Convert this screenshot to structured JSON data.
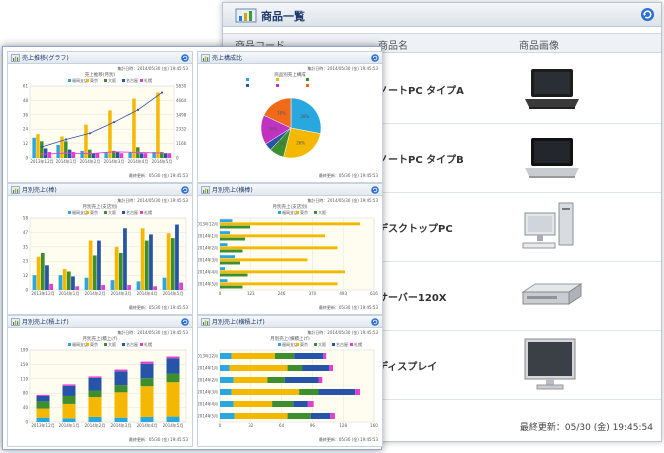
{
  "product_window": {
    "title": "商品一覧",
    "columns": [
      "商品コード",
      "商品名",
      "商品画像"
    ],
    "products": [
      {
        "name": "ノートPC タイプA",
        "icon": "laptop-icon"
      },
      {
        "name": "ノートPC タイプB",
        "icon": "laptop-icon"
      },
      {
        "name": "デスクトップPC",
        "icon": "desktop-pc-icon"
      },
      {
        "name": "サーバー120X",
        "icon": "server-icon"
      },
      {
        "name": "ディスプレイ",
        "icon": "monitor-icon"
      }
    ],
    "last_updated": "最終更新：05/30 (金) 19:45:54"
  },
  "dashboard": {
    "panels": [
      {
        "title": "売上推移(グラフ)",
        "meta": "集計日時：2014/05/30 (金) 19:45:53",
        "subtitle": "売上推移(月別)",
        "date_footer": "最終更新：05/30 (金) 19:45:53"
      },
      {
        "title": "売上構成比",
        "meta": "集計日時：2014/05/30 (金) 19:45:53",
        "subtitle": "商品別売上構成",
        "date_footer": "最終更新：05/30 (金) 19:45:53"
      },
      {
        "title": "月別売上(棒)",
        "meta": "集計日時：2014/05/30 (金) 19:45:53",
        "subtitle": "月別売上(支店別)",
        "date_footer": "最終更新：05/30 (金) 19:45:53"
      },
      {
        "title": "月別売上(横棒)",
        "meta": "集計日時：2014/05/30 (金) 19:45:53",
        "subtitle": "月別売上(支店別)",
        "date_footer": "最終更新：05/30 (金) 19:45:53"
      },
      {
        "title": "月別売上(積上げ)",
        "meta": "集計日時：2014/05/30 (金) 19:45:53",
        "subtitle": "月別売上(積上げ)",
        "date_footer": "最終更新：05/30 (金) 19:45:53"
      },
      {
        "title": "月別売上(横積上げ)",
        "meta": "集計日時：2014/05/30 (金) 19:45:53",
        "subtitle": "月別売上(横積上げ)",
        "date_footer": "最終更新：05/30 (金) 19:45:53"
      }
    ]
  },
  "chart_data": [
    {
      "type": "bar",
      "categories": [
        "2013年12月",
        "2014年1月",
        "2014年2月",
        "2014年3月",
        "2014年4月",
        "2014年5月"
      ],
      "series": [
        {
          "name": "福岡支店",
          "values": [
            17,
            11,
            6,
            5,
            5,
            5
          ]
        },
        {
          "name": "東京",
          "values": [
            20,
            18,
            28,
            40,
            50,
            55
          ]
        },
        {
          "name": "大阪",
          "values": [
            14,
            14,
            7,
            6,
            9,
            5
          ]
        },
        {
          "name": "名古屋",
          "values": [
            8,
            7,
            4,
            5,
            4,
            4
          ]
        },
        {
          "name": "札幌",
          "values": [
            5,
            5,
            4,
            4,
            4,
            4
          ]
        }
      ],
      "line_series": [
        {
          "name": "累計",
          "values": [
            900,
            1500,
            2000,
            2900,
            3900,
            5300
          ]
        },
        {
          "name": "平均",
          "values": [
            300,
            400,
            350,
            500,
            450,
            400
          ]
        }
      ],
      "colors": [
        "#29a8e0",
        "#f5b800",
        "#3d8f2e",
        "#2554a8",
        "#e040d0"
      ]
    },
    {
      "type": "pie",
      "values": [
        28,
        26,
        8,
        4,
        16,
        18
      ],
      "slice_labels": [
        "28%",
        "26%",
        "8%",
        "4%",
        "16%",
        "18%"
      ],
      "colors": [
        "#29a8e0",
        "#f5b800",
        "#3d8f2e",
        "#2554a8",
        "#c032c0",
        "#f06a1a"
      ]
    },
    {
      "type": "bar",
      "categories": [
        "2013年12月",
        "2014年1月",
        "2014年2月",
        "2014年3月",
        "2014年4月",
        "2014年5月"
      ],
      "series": [
        {
          "name": "福岡支店",
          "values": [
            12,
            12,
            10,
            8,
            7,
            10
          ]
        },
        {
          "name": "東京",
          "values": [
            27,
            17,
            40,
            35,
            50,
            46
          ]
        },
        {
          "name": "大阪",
          "values": [
            30,
            15,
            28,
            30,
            40,
            42
          ]
        },
        {
          "name": "名古屋",
          "values": [
            20,
            11,
            40,
            50,
            45,
            53
          ]
        },
        {
          "name": "札幌",
          "values": [
            5,
            3,
            4,
            4,
            3,
            6
          ]
        }
      ],
      "colors": [
        "#29a8e0",
        "#f5b800",
        "#3d8f2e",
        "#2554a8",
        "#e040d0"
      ]
    },
    {
      "type": "bar",
      "orientation": "horizontal",
      "categories": [
        "2013年12月",
        "2014年1月",
        "2014年2月",
        "2014年3月",
        "2014年4月",
        "2014年5月"
      ],
      "series": [
        {
          "name": "福岡支店",
          "values": [
            50,
            40,
            30,
            60,
            20,
            30
          ]
        },
        {
          "name": "東京",
          "values": [
            560,
            420,
            470,
            350,
            500,
            470
          ]
        },
        {
          "name": "大阪",
          "values": [
            120,
            100,
            90,
            80,
            110,
            90
          ]
        }
      ],
      "colors": [
        "#29a8e0",
        "#f5b800",
        "#3d8f2e"
      ]
    },
    {
      "type": "bar",
      "stacked": true,
      "categories": [
        "2013年12月",
        "2014年1月",
        "2014年2月",
        "2014年3月",
        "2014年4月",
        "2014年5月"
      ],
      "series": [
        {
          "name": "福岡支店",
          "values": [
            12,
            10,
            14,
            12,
            14,
            15
          ]
        },
        {
          "name": "東京",
          "values": [
            25,
            40,
            55,
            70,
            85,
            95
          ]
        },
        {
          "name": "大阪",
          "values": [
            20,
            22,
            18,
            20,
            22,
            24
          ]
        },
        {
          "name": "名古屋",
          "values": [
            15,
            28,
            35,
            38,
            40,
            42
          ]
        },
        {
          "name": "札幌",
          "values": [
            3,
            4,
            4,
            5,
            6,
            5
          ]
        }
      ],
      "colors": [
        "#29a8e0",
        "#f5b800",
        "#3d8f2e",
        "#2554a8",
        "#e040d0"
      ]
    },
    {
      "type": "bar",
      "orientation": "horizontal",
      "stacked": true,
      "categories": [
        "2013年12月",
        "2014年1月",
        "2014年2月",
        "2014年3月",
        "2014年4月",
        "2014年5月"
      ],
      "series": [
        {
          "name": "福岡支店",
          "values": [
            12,
            10,
            14,
            12,
            14,
            15
          ]
        },
        {
          "name": "東京",
          "values": [
            45,
            60,
            35,
            70,
            40,
            55
          ]
        },
        {
          "name": "大阪",
          "values": [
            20,
            15,
            18,
            20,
            22,
            24
          ]
        },
        {
          "name": "名古屋",
          "values": [
            30,
            28,
            35,
            38,
            15,
            20
          ]
        },
        {
          "name": "札幌",
          "values": [
            3,
            4,
            4,
            5,
            6,
            5
          ]
        }
      ],
      "colors": [
        "#29a8e0",
        "#f5b800",
        "#3d8f2e",
        "#2554a8",
        "#e040d0"
      ]
    }
  ]
}
